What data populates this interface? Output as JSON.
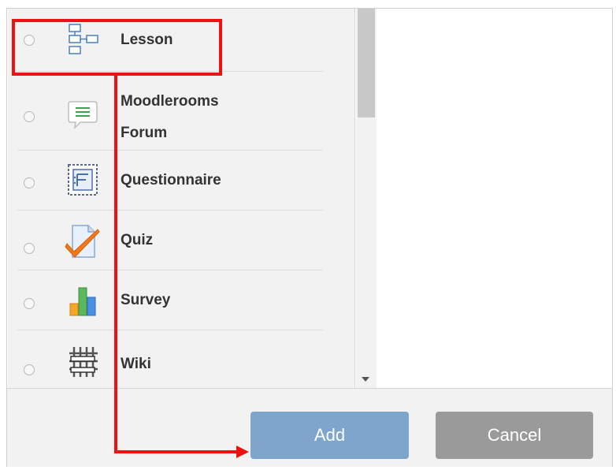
{
  "activities": [
    {
      "label": "Lesson",
      "icon": "lesson-icon",
      "selected": false
    },
    {
      "label": "Moodlerooms Forum",
      "label_line1": "Moodlerooms",
      "label_line2": "Forum",
      "icon": "forum-icon",
      "selected": false
    },
    {
      "label": "Questionnaire",
      "icon": "questionnaire-icon",
      "selected": false
    },
    {
      "label": "Quiz",
      "icon": "quiz-icon",
      "selected": false
    },
    {
      "label": "Survey",
      "icon": "survey-icon",
      "selected": false
    },
    {
      "label": "Wiki",
      "icon": "wiki-icon",
      "selected": false
    }
  ],
  "footer": {
    "add_label": "Add",
    "cancel_label": "Cancel"
  },
  "colors": {
    "highlight": "#ee1111",
    "add_button": "#7ea5cc",
    "cancel_button": "#9a9a9a",
    "panel_bg": "#f2f2f2"
  }
}
